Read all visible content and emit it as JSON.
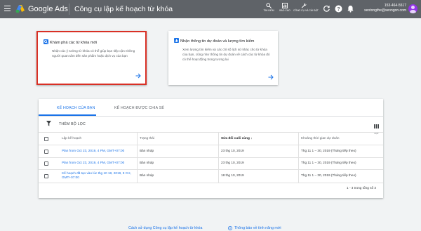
{
  "header": {
    "brand": "Google Ads",
    "title": "Công cụ lập kế hoạch từ khóa",
    "tools": [
      {
        "icon": "search-icon",
        "label": "TÌM KIẾM"
      },
      {
        "icon": "reports-icon",
        "label": "BÁO CÁO"
      },
      {
        "icon": "wrench-icon",
        "label": "CÔNG CỤ VÀ CÀI ĐẶT"
      }
    ],
    "account_id": "153-464-5517",
    "account_email": "seotongthe@seongon.com"
  },
  "cards": [
    {
      "title": "Khám phá các từ khóa mới",
      "description": "Nhận các ý tưởng từ khóa có thể giúp bạn tiếp cận những người quan tâm đến sản phẩm hoặc dịch vụ của bạn",
      "icon": "search-icon"
    },
    {
      "title": "Nhận thông tin dự đoán và lượng tìm kiếm",
      "description": "Xem lượng tìm kiếm và các chỉ số lịch sử khác cho từ khóa của bạn, cũng như thông tin dự đoán về cách các từ khóa đó có thể hoạt động trong tương lai",
      "icon": "forecast-icon"
    }
  ],
  "tabs": [
    "KẾ HOẠCH CỦA BẠN",
    "KẾ HOẠCH ĐƯỢC CHIA SẺ"
  ],
  "filter_label": "THÊM BỘ LỌC",
  "columns_label": "CỘT",
  "table": {
    "headers": [
      "Lập kế hoạch",
      "Trạng thái",
      "Sửa đổi cuối cùng",
      "Khoảng thời gian dự đoán"
    ],
    "rows": [
      [
        "Plan from Oct 23, 2019, 4 PM, GMT+07:00",
        "Bản nháp",
        "23 thg 10, 2019",
        "Thg 11 1 – 30, 2019 (Tháng tiếp theo)"
      ],
      [
        "Plan from Oct 23, 2019, 4 PM, GMT+07:00",
        "Bản nháp",
        "23 thg 10, 2019",
        "Thg 11 1 – 30, 2019 (Tháng tiếp theo)"
      ],
      [
        "Kế hoạch đã tạo vào lúc thg 10 18, 2019, 9 CH, GMT+07:00",
        "Bản nháp",
        "18 thg 10, 2019",
        "Thg 11 1 – 30, 2019 (Tháng tiếp theo)"
      ]
    ]
  },
  "pagination": "1 - 3 trong tổng số 3",
  "footer": {
    "help_link": "Cách sử dụng Công cụ lập kế hoạch từ khóa",
    "notice_link": "Thông báo về tính năng mới"
  }
}
